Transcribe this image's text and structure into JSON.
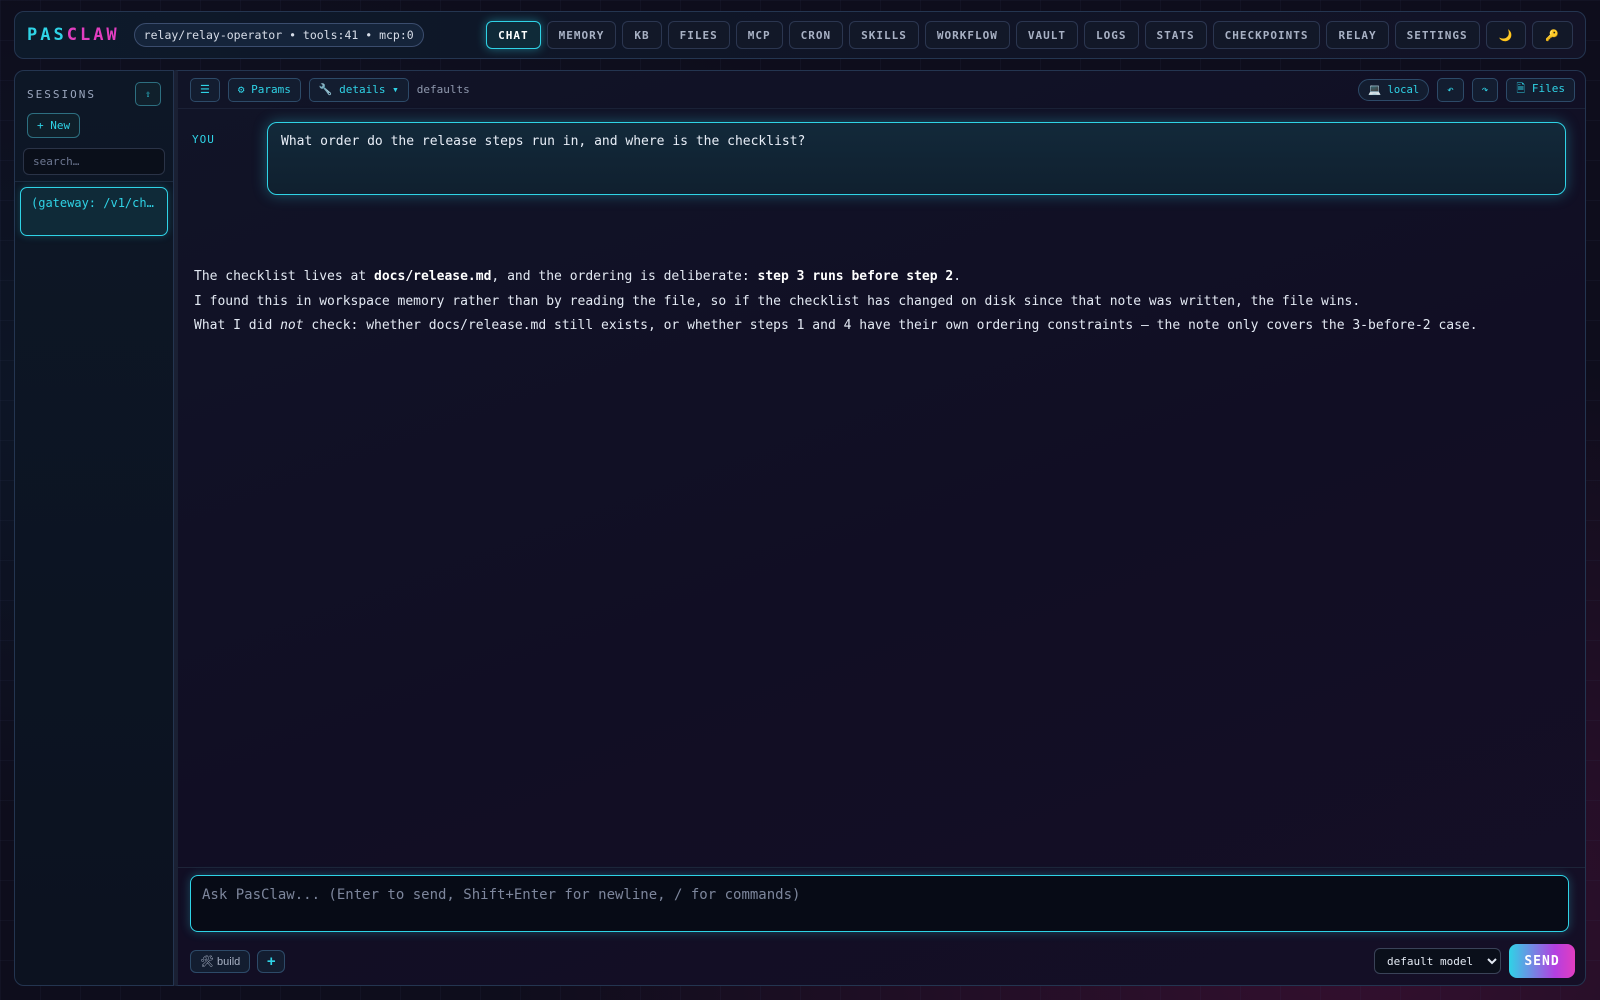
{
  "brand": {
    "part1": "PAS",
    "part2": "CLAW"
  },
  "status_pill": "relay/relay-operator • tools:41 • mcp:0",
  "nav": [
    {
      "label": "CHAT",
      "active": true
    },
    {
      "label": "MEMORY"
    },
    {
      "label": "KB"
    },
    {
      "label": "FILES"
    },
    {
      "label": "MCP"
    },
    {
      "label": "CRON"
    },
    {
      "label": "SKILLS"
    },
    {
      "label": "WORKFLOW"
    },
    {
      "label": "VAULT"
    },
    {
      "label": "LOGS"
    },
    {
      "label": "STATS"
    },
    {
      "label": "CHECKPOINTS"
    },
    {
      "label": "RELAY"
    },
    {
      "label": "SETTINGS"
    }
  ],
  "nav_icons": {
    "theme": "🌙",
    "key": "🔑"
  },
  "sidebar": {
    "title": "SESSIONS",
    "collapse_glyph": "⇧",
    "new_label": "+ New",
    "search_placeholder": "search…",
    "sessions": [
      {
        "label": "(gateway: /v1/ch…"
      }
    ]
  },
  "toolbar": {
    "menu_glyph": "☰",
    "params_label": "⚙ Params",
    "details_label": "🔧 details ▾",
    "defaults_text": "defaults",
    "local_label": "💻 local",
    "undo_glyph": "↶",
    "redo_glyph": "↷",
    "files_label": "🗎 Files"
  },
  "chat": {
    "user_label": "YOU",
    "user_message": "What order do the release steps run in, and where is the checklist?",
    "reply": {
      "l1_a": "The checklist lives at ",
      "l1_b": "docs/release.md",
      "l1_c": ", and the ordering is deliberate: ",
      "l1_d": "step 3 runs before step 2",
      "l1_e": ".",
      "l2": "I found this in workspace memory rather than by reading the file, so if the checklist has changed on disk since that note was written, the file wins.",
      "l3_a": "What I did ",
      "l3_b": "not",
      "l3_c": " check: whether docs/release.md still exists, or whether steps 1 and 4 have their own ordering constraints — the note only covers the 3-before-2 case."
    }
  },
  "composer": {
    "placeholder": "Ask PasClaw... (Enter to send, Shift+Enter for newline, / for commands)",
    "build_label": "🛠 build",
    "plus_label": "+",
    "model_options": [
      "default model"
    ],
    "model_selected": "default model",
    "send_label": "SEND"
  },
  "colors": {
    "accent_cyan": "#2fd3e6",
    "accent_magenta": "#e23ec0",
    "bg": "#0e0d1c"
  }
}
